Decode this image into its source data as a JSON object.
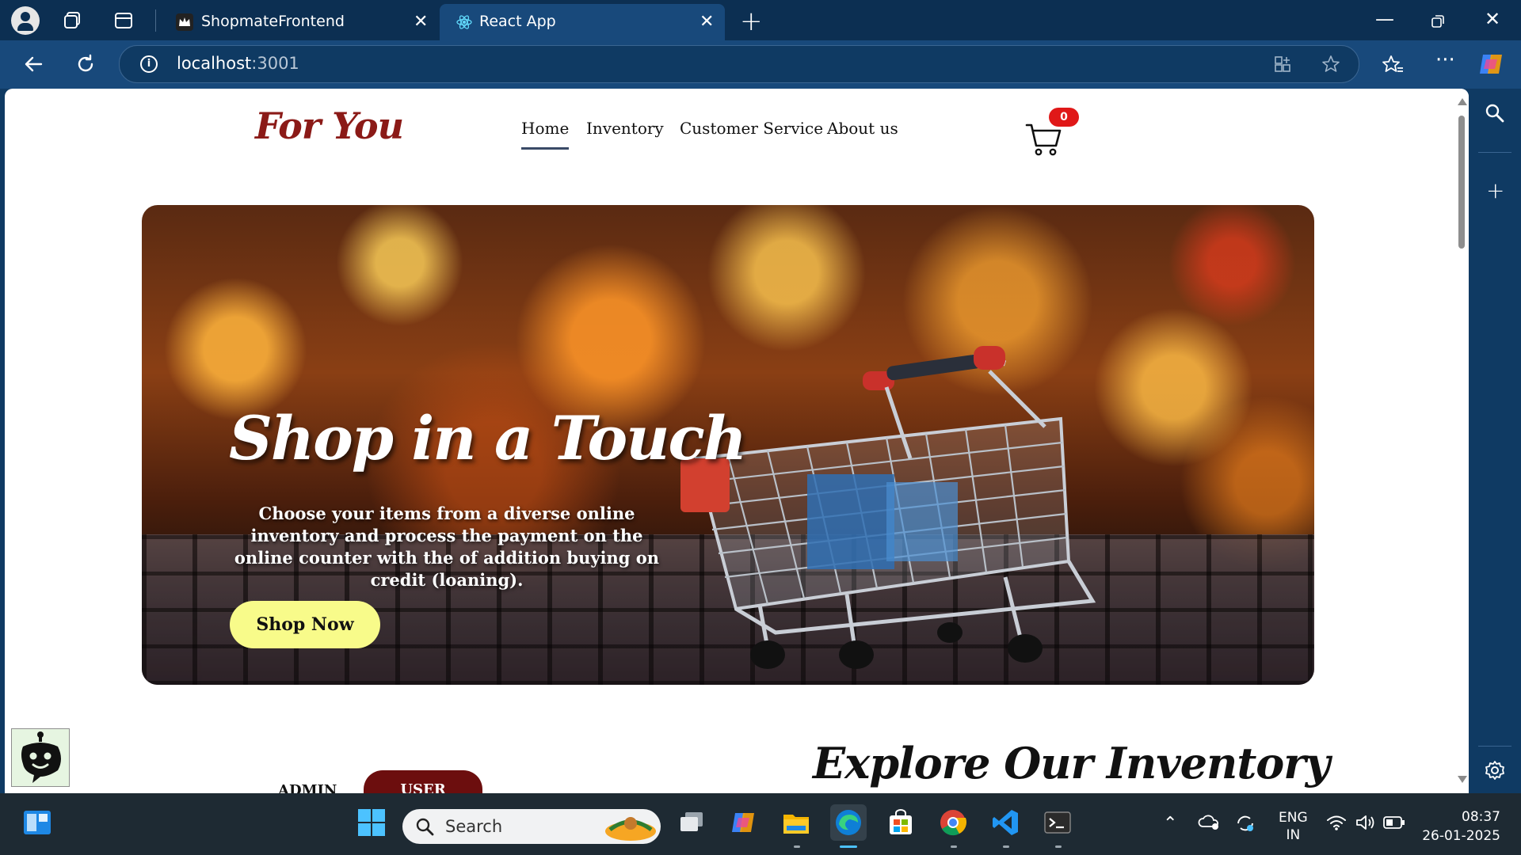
{
  "browser": {
    "tabs": [
      {
        "title": "ShopmateFrontend",
        "active": false
      },
      {
        "title": "React App",
        "active": true
      }
    ],
    "url_host": "localhost",
    "url_port": ":3001"
  },
  "site": {
    "logo": "For You",
    "nav": [
      "Home",
      "Inventory",
      "Customer Service",
      "About us"
    ],
    "active_nav": "Home",
    "cart_count": "0"
  },
  "hero": {
    "title": "Shop in a Touch",
    "text": "Choose your items from a diverse online inventory and process the payment on the online counter with the of addition buying on credit (loaning).",
    "button": "Shop Now"
  },
  "bottom": {
    "tab_admin": "ADMIN",
    "tab_user": "USER",
    "heading": "Explore Our Inventory"
  },
  "taskbar": {
    "search_placeholder": "Search",
    "language": "ENG",
    "region": "IN",
    "time": "08:37",
    "date": "26-01-2025"
  },
  "colors": {
    "logo": "#8b1a17",
    "shop_button": "#f8fb8a",
    "user_tab": "#6c0e0e",
    "badge": "#e01818",
    "browser_chrome": "#18497b"
  }
}
